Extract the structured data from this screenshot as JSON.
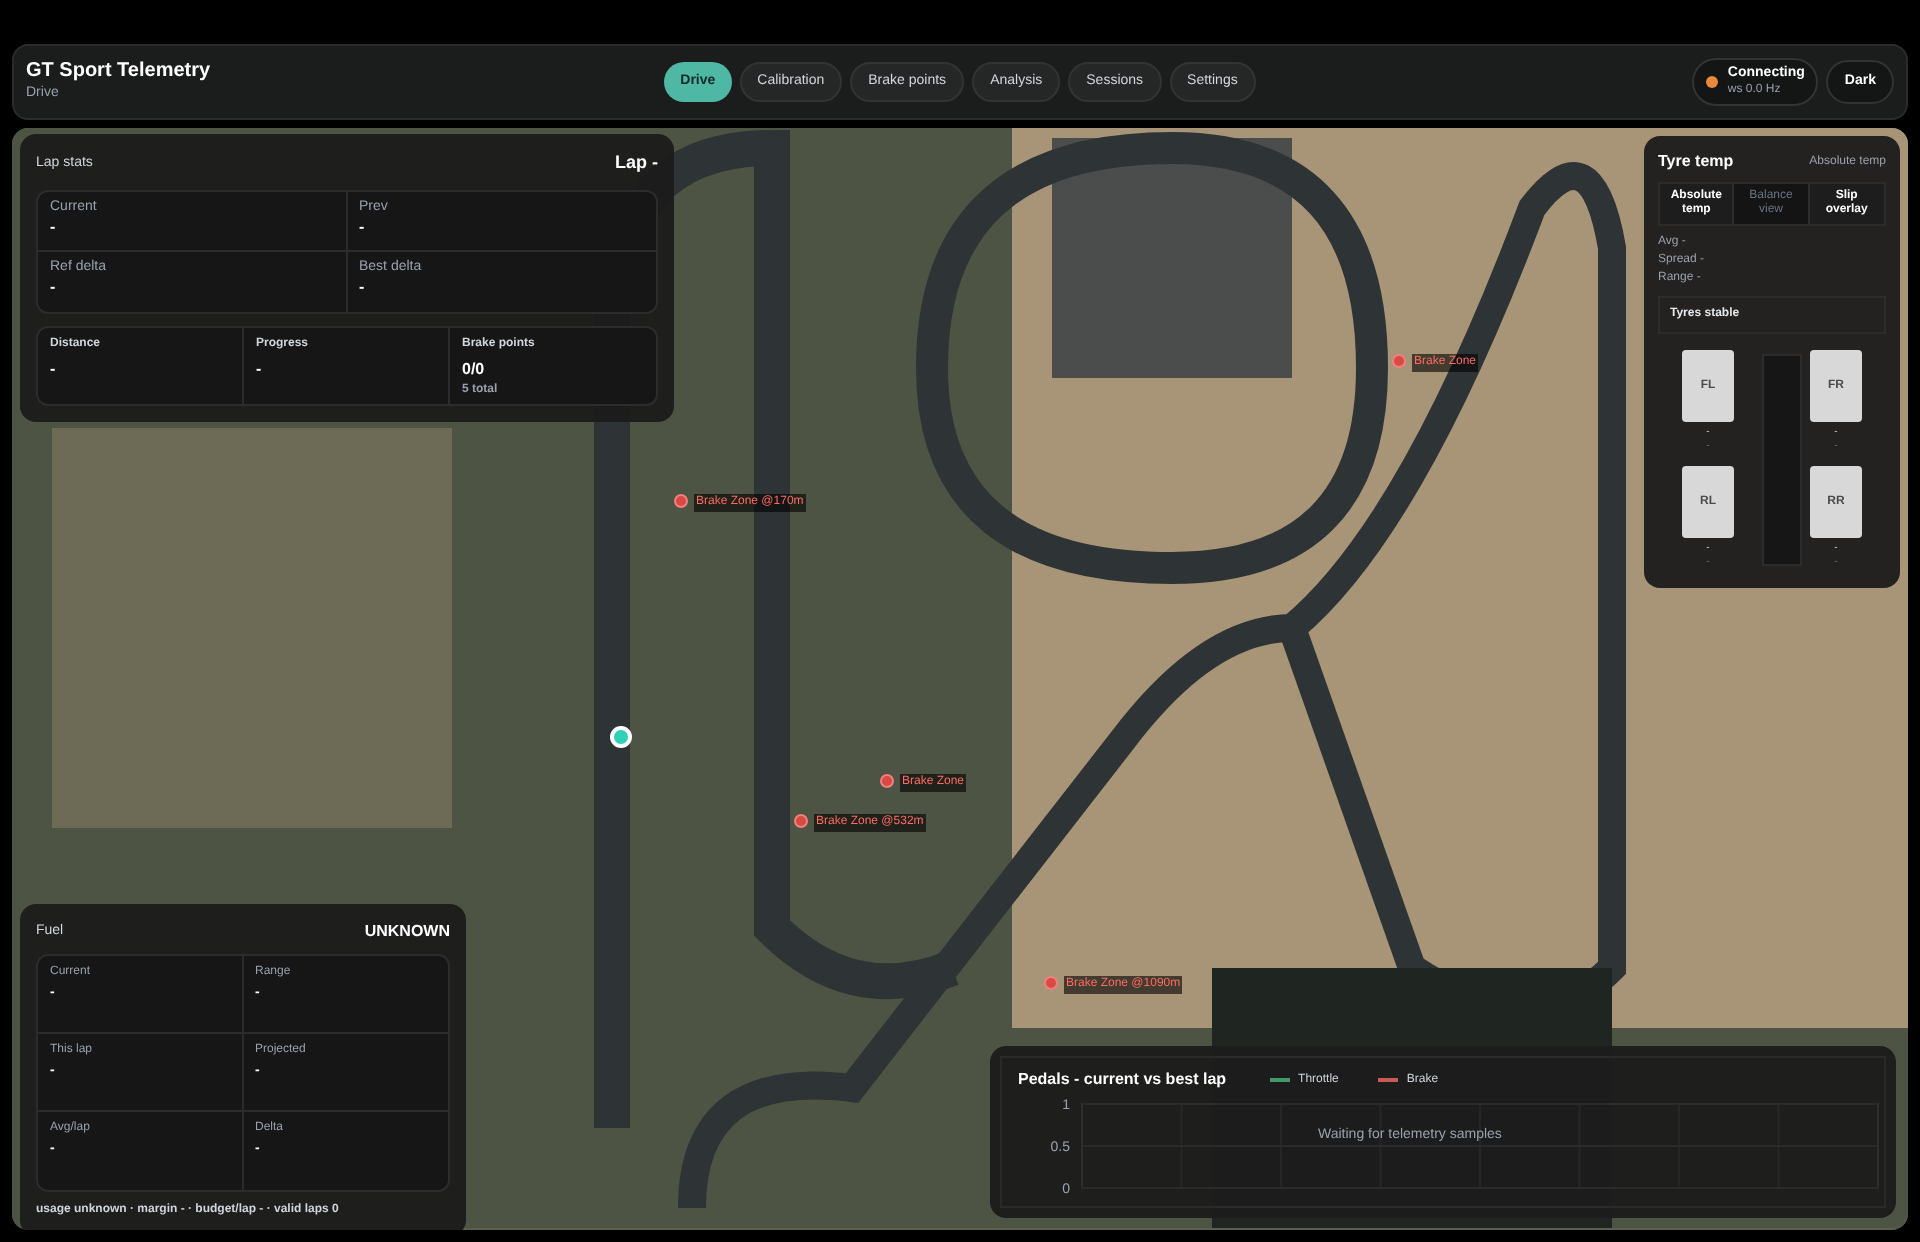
{
  "app": {
    "title": "GT Sport Telemetry",
    "subtitle": "Drive"
  },
  "tabs": [
    {
      "label": "Drive",
      "selected": true
    },
    {
      "label": "Calibration",
      "selected": false
    },
    {
      "label": "Brake points",
      "selected": false
    },
    {
      "label": "Analysis",
      "selected": false
    },
    {
      "label": "Sessions",
      "selected": false
    },
    {
      "label": "Settings",
      "selected": false
    }
  ],
  "connection": {
    "status": "Connecting",
    "rate": "ws 0.0 Hz",
    "color": "#e8893a"
  },
  "theme_button": "Dark",
  "map": {
    "brake_markers": [
      {
        "label": "Brake Zone"
      },
      {
        "label": "Brake Zone @170m"
      },
      {
        "label": "Brake Zone"
      },
      {
        "label": "Brake Zone @532m"
      },
      {
        "label": "Brake Zone @1090m"
      }
    ]
  },
  "lap_stats": {
    "title": "Lap stats",
    "lap": "Lap -",
    "cells": [
      {
        "label": "Current",
        "value": "-"
      },
      {
        "label": "Prev",
        "value": "-"
      },
      {
        "label": "Ref delta",
        "value": "-"
      },
      {
        "label": "Best delta",
        "value": "-"
      }
    ],
    "summary": [
      {
        "label": "Distance",
        "value": "-"
      },
      {
        "label": "Progress",
        "value": "-"
      },
      {
        "label": "Brake points",
        "value": "0/0",
        "note": "5 total"
      }
    ]
  },
  "tyre_temp": {
    "title": "Tyre temp",
    "mode": "Absolute temp",
    "toggles": [
      {
        "label": "Absolute temp",
        "selected": true
      },
      {
        "label": "Balance view",
        "selected": false
      },
      {
        "label": "Slip overlay",
        "selected": true
      }
    ],
    "stats": [
      "Avg -",
      "Spread -",
      "Range -"
    ],
    "status": "Tyres stable",
    "tyres": [
      {
        "label": "FL",
        "line_1": "-",
        "line_2": "-"
      },
      {
        "label": "FR",
        "line_1": "-",
        "line_2": "-"
      },
      {
        "label": "RL",
        "line_1": "-",
        "line_2": "-"
      },
      {
        "label": "RR",
        "line_1": "-",
        "line_2": "-"
      }
    ]
  },
  "fuel": {
    "title": "Fuel",
    "status": "UNKNOWN",
    "cells": [
      {
        "label": "Current",
        "value": "-"
      },
      {
        "label": "Range",
        "value": "-"
      },
      {
        "label": "This lap",
        "value": "-"
      },
      {
        "label": "Projected",
        "value": "-"
      },
      {
        "label": "Avg/lap",
        "value": "-"
      },
      {
        "label": "Delta",
        "value": "-"
      }
    ],
    "footer": "usage unknown · margin - · budget/lap - · valid laps 0"
  },
  "pedals": {
    "empty_message": "Waiting for telemetry samples",
    "chart_data": {
      "type": "line",
      "title": "Pedals - current vs best lap",
      "ylim": [
        0,
        1
      ],
      "yticks": [
        0,
        0.5,
        1
      ],
      "series": [
        {
          "name": "Throttle",
          "color": "#3f9a6a"
        },
        {
          "name": "Brake",
          "color": "#c85a55"
        }
      ]
    }
  }
}
